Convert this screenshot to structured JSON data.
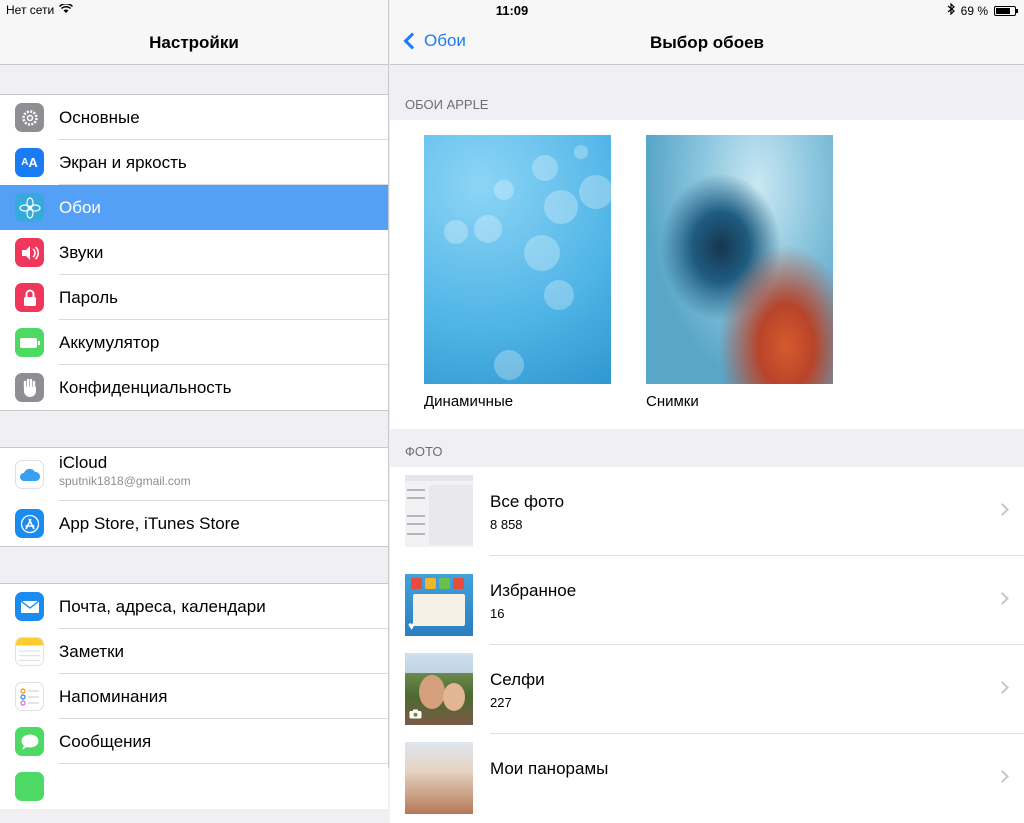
{
  "status": {
    "carrier": "Нет сети",
    "time": "11:09",
    "battery": "69 %",
    "battery_level": 0.69
  },
  "left": {
    "title": "Настройки",
    "group1": [
      {
        "label": "Основные",
        "icon": "gear-icon",
        "color": "#8e8e93"
      },
      {
        "label": "Экран и яркость",
        "icon": "text-size-icon",
        "color": "#1a7cf5"
      },
      {
        "label": "Обои",
        "icon": "flower-icon",
        "color": "#36aadc",
        "selected": true
      },
      {
        "label": "Звуки",
        "icon": "speaker-icon",
        "color": "#f0365a"
      },
      {
        "label": "Пароль",
        "icon": "lock-icon",
        "color": "#f0365a"
      },
      {
        "label": "Аккумулятор",
        "icon": "battery-icon",
        "color": "#4cd964"
      },
      {
        "label": "Конфиденциальность",
        "icon": "hand-icon",
        "color": "#8e8e93"
      }
    ],
    "icloud": {
      "label": "iCloud",
      "email": "sputnik1818@gmail.com",
      "icon": "cloud-icon",
      "color": "#ffffff"
    },
    "appstore": {
      "label": "App Store, iTunes Store",
      "icon": "appstore-icon",
      "color": "#1a8cf0"
    },
    "group3": [
      {
        "label": "Почта, адреса, календари",
        "icon": "mail-icon",
        "color": "#1a8cf0"
      },
      {
        "label": "Заметки",
        "icon": "notes-icon",
        "color": "#fecc2f"
      },
      {
        "label": "Напоминания",
        "icon": "reminders-icon",
        "color": "#ffffff"
      },
      {
        "label": "Сообщения",
        "icon": "messages-icon",
        "color": "#4cd964"
      }
    ]
  },
  "right": {
    "back": "Обои",
    "title": "Выбор обоев",
    "apple_header": "ОБОИ APPLE",
    "wallpapers": [
      "Динамичные",
      "Снимки"
    ],
    "photo_header": "ФОТО",
    "albums": [
      {
        "name": "Все фото",
        "count": "8 858"
      },
      {
        "name": "Избранное",
        "count": "16"
      },
      {
        "name": "Селфи",
        "count": "227"
      },
      {
        "name": "Мои панорамы",
        "count": ""
      }
    ]
  }
}
